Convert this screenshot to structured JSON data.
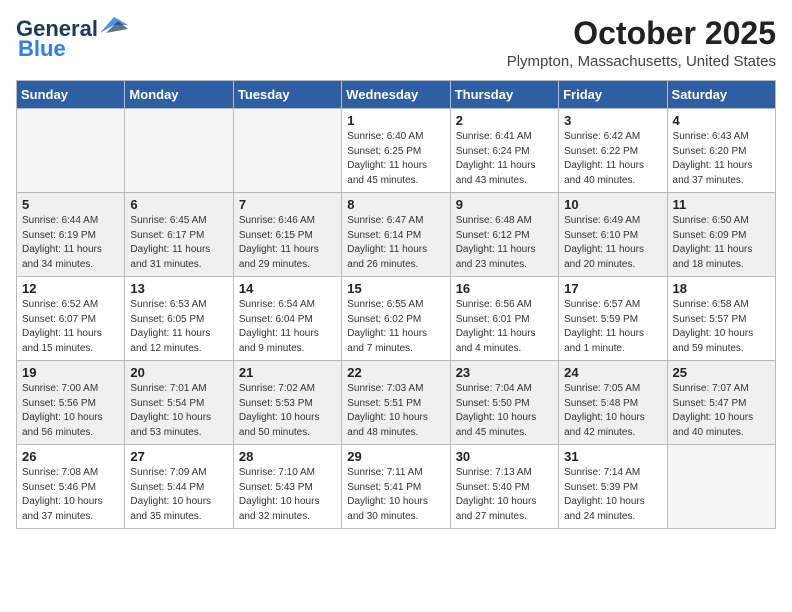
{
  "header": {
    "logo_general": "General",
    "logo_blue": "Blue",
    "month_title": "October 2025",
    "location": "Plympton, Massachusetts, United States"
  },
  "days_of_week": [
    "Sunday",
    "Monday",
    "Tuesday",
    "Wednesday",
    "Thursday",
    "Friday",
    "Saturday"
  ],
  "weeks": [
    [
      {
        "day": "",
        "info": ""
      },
      {
        "day": "",
        "info": ""
      },
      {
        "day": "",
        "info": ""
      },
      {
        "day": "1",
        "info": "Sunrise: 6:40 AM\nSunset: 6:25 PM\nDaylight: 11 hours\nand 45 minutes."
      },
      {
        "day": "2",
        "info": "Sunrise: 6:41 AM\nSunset: 6:24 PM\nDaylight: 11 hours\nand 43 minutes."
      },
      {
        "day": "3",
        "info": "Sunrise: 6:42 AM\nSunset: 6:22 PM\nDaylight: 11 hours\nand 40 minutes."
      },
      {
        "day": "4",
        "info": "Sunrise: 6:43 AM\nSunset: 6:20 PM\nDaylight: 11 hours\nand 37 minutes."
      }
    ],
    [
      {
        "day": "5",
        "info": "Sunrise: 6:44 AM\nSunset: 6:19 PM\nDaylight: 11 hours\nand 34 minutes."
      },
      {
        "day": "6",
        "info": "Sunrise: 6:45 AM\nSunset: 6:17 PM\nDaylight: 11 hours\nand 31 minutes."
      },
      {
        "day": "7",
        "info": "Sunrise: 6:46 AM\nSunset: 6:15 PM\nDaylight: 11 hours\nand 29 minutes."
      },
      {
        "day": "8",
        "info": "Sunrise: 6:47 AM\nSunset: 6:14 PM\nDaylight: 11 hours\nand 26 minutes."
      },
      {
        "day": "9",
        "info": "Sunrise: 6:48 AM\nSunset: 6:12 PM\nDaylight: 11 hours\nand 23 minutes."
      },
      {
        "day": "10",
        "info": "Sunrise: 6:49 AM\nSunset: 6:10 PM\nDaylight: 11 hours\nand 20 minutes."
      },
      {
        "day": "11",
        "info": "Sunrise: 6:50 AM\nSunset: 6:09 PM\nDaylight: 11 hours\nand 18 minutes."
      }
    ],
    [
      {
        "day": "12",
        "info": "Sunrise: 6:52 AM\nSunset: 6:07 PM\nDaylight: 11 hours\nand 15 minutes."
      },
      {
        "day": "13",
        "info": "Sunrise: 6:53 AM\nSunset: 6:05 PM\nDaylight: 11 hours\nand 12 minutes."
      },
      {
        "day": "14",
        "info": "Sunrise: 6:54 AM\nSunset: 6:04 PM\nDaylight: 11 hours\nand 9 minutes."
      },
      {
        "day": "15",
        "info": "Sunrise: 6:55 AM\nSunset: 6:02 PM\nDaylight: 11 hours\nand 7 minutes."
      },
      {
        "day": "16",
        "info": "Sunrise: 6:56 AM\nSunset: 6:01 PM\nDaylight: 11 hours\nand 4 minutes."
      },
      {
        "day": "17",
        "info": "Sunrise: 6:57 AM\nSunset: 5:59 PM\nDaylight: 11 hours\nand 1 minute."
      },
      {
        "day": "18",
        "info": "Sunrise: 6:58 AM\nSunset: 5:57 PM\nDaylight: 10 hours\nand 59 minutes."
      }
    ],
    [
      {
        "day": "19",
        "info": "Sunrise: 7:00 AM\nSunset: 5:56 PM\nDaylight: 10 hours\nand 56 minutes."
      },
      {
        "day": "20",
        "info": "Sunrise: 7:01 AM\nSunset: 5:54 PM\nDaylight: 10 hours\nand 53 minutes."
      },
      {
        "day": "21",
        "info": "Sunrise: 7:02 AM\nSunset: 5:53 PM\nDaylight: 10 hours\nand 50 minutes."
      },
      {
        "day": "22",
        "info": "Sunrise: 7:03 AM\nSunset: 5:51 PM\nDaylight: 10 hours\nand 48 minutes."
      },
      {
        "day": "23",
        "info": "Sunrise: 7:04 AM\nSunset: 5:50 PM\nDaylight: 10 hours\nand 45 minutes."
      },
      {
        "day": "24",
        "info": "Sunrise: 7:05 AM\nSunset: 5:48 PM\nDaylight: 10 hours\nand 42 minutes."
      },
      {
        "day": "25",
        "info": "Sunrise: 7:07 AM\nSunset: 5:47 PM\nDaylight: 10 hours\nand 40 minutes."
      }
    ],
    [
      {
        "day": "26",
        "info": "Sunrise: 7:08 AM\nSunset: 5:46 PM\nDaylight: 10 hours\nand 37 minutes."
      },
      {
        "day": "27",
        "info": "Sunrise: 7:09 AM\nSunset: 5:44 PM\nDaylight: 10 hours\nand 35 minutes."
      },
      {
        "day": "28",
        "info": "Sunrise: 7:10 AM\nSunset: 5:43 PM\nDaylight: 10 hours\nand 32 minutes."
      },
      {
        "day": "29",
        "info": "Sunrise: 7:11 AM\nSunset: 5:41 PM\nDaylight: 10 hours\nand 30 minutes."
      },
      {
        "day": "30",
        "info": "Sunrise: 7:13 AM\nSunset: 5:40 PM\nDaylight: 10 hours\nand 27 minutes."
      },
      {
        "day": "31",
        "info": "Sunrise: 7:14 AM\nSunset: 5:39 PM\nDaylight: 10 hours\nand 24 minutes."
      },
      {
        "day": "",
        "info": ""
      }
    ]
  ]
}
